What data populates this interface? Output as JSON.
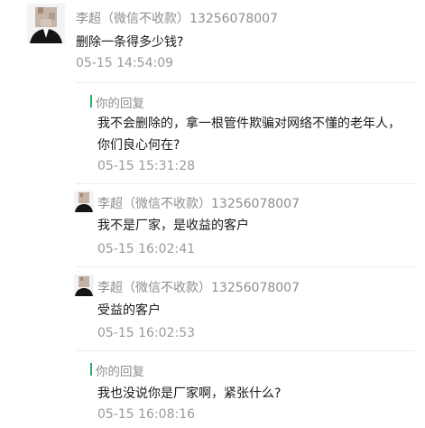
{
  "main_comment": {
    "author": "李超（微信不收款）13256078007",
    "text": "删除一条得多少钱?",
    "time": "05-15 14:54:09",
    "avatar_icon": "user-avatar-pixelated"
  },
  "replies": [
    {
      "kind": "self",
      "label": "你的回复",
      "text": "我不会删除的，拿一根管件欺骗对网络不懂的老年人，你们良心何在?",
      "time": "05-15 15:31:28"
    },
    {
      "kind": "user",
      "author": "李超（微信不收款）13256078007",
      "text": "我不是厂家，是收益的客户",
      "time": "05-15 16:02:41"
    },
    {
      "kind": "user",
      "author": "李超（微信不收款）13256078007",
      "text": "受益的客户",
      "time": "05-15 16:02:53"
    },
    {
      "kind": "self",
      "label": "你的回复",
      "text": "我也没说你是厂家啊，紧张什么?",
      "time": "05-15 16:08:16"
    }
  ],
  "colors": {
    "accent_green": "#2aae67",
    "meta_gray": "#8e8e8e",
    "divider": "#ececec"
  }
}
